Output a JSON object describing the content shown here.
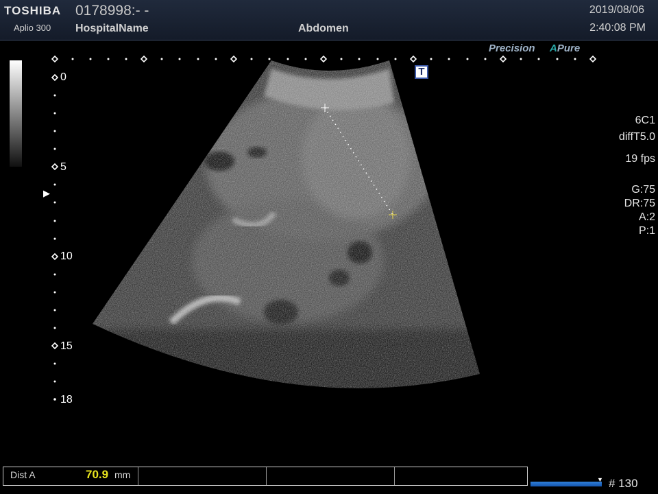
{
  "header": {
    "brand": "TOSHIBA",
    "model": "Aplio 300",
    "patient_id": "0178998:- -",
    "hospital": "HospitalName",
    "exam": "Abdomen",
    "date": "2019/08/06",
    "time": "2:40:08 PM"
  },
  "processing": {
    "precision_label": "Precision",
    "apure_prefix": "A",
    "apure_label": "Pure"
  },
  "annotation": {
    "t_marker": "T"
  },
  "depth_scale": {
    "labels": [
      "0",
      "5",
      "10",
      "15",
      "18"
    ],
    "max_cm": 18
  },
  "params": {
    "probe": "6C1",
    "mode": "diffT5.0",
    "fps": "19 fps",
    "gain": "G:75",
    "dynamic_range": "DR:75",
    "a": "A:2",
    "p": "P:1"
  },
  "measurement": {
    "label": "Dist A",
    "value": "70.9",
    "unit": "mm"
  },
  "cine": {
    "frame_label": "# 130"
  },
  "colors": {
    "header_bg": "#1a2233",
    "measure_value": "#e8e41e",
    "cine_bar": "#2f7fd8",
    "apure_accent": "#2aa8a8"
  },
  "icons": [
    "focus-marker-icon",
    "caliper-cross-icon",
    "cine-position-icon"
  ]
}
